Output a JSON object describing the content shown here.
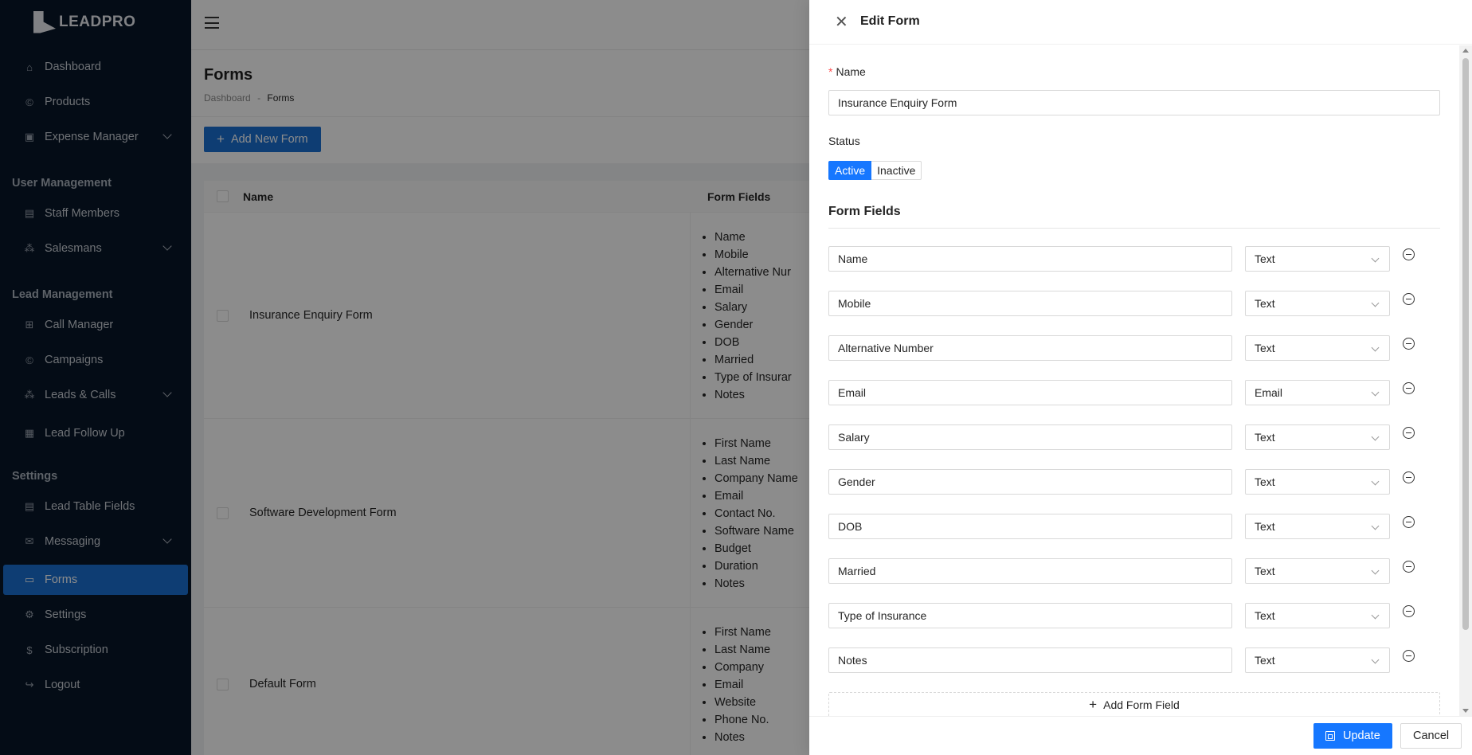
{
  "brand": {
    "name": "LEADPRO"
  },
  "sidebar": {
    "items": [
      {
        "label": "Dashboard",
        "icon": "home-icon",
        "glyph": "⌂"
      },
      {
        "label": "Products",
        "icon": "copyright-icon",
        "glyph": "©"
      },
      {
        "label": "Expense Manager",
        "icon": "ledger-icon",
        "glyph": "▣"
      }
    ],
    "group_user": "User Management",
    "user_items": [
      {
        "label": "Staff Members",
        "icon": "document-icon",
        "glyph": "▤"
      },
      {
        "label": "Salesmans",
        "icon": "cluster-icon",
        "glyph": "⁂"
      }
    ],
    "group_lead": "Lead Management",
    "lead_items": [
      {
        "label": "Call Manager",
        "icon": "grid-icon",
        "glyph": "⊞"
      },
      {
        "label": "Campaigns",
        "icon": "copyright-icon",
        "glyph": "©"
      },
      {
        "label": "Leads & Calls",
        "icon": "cluster-icon",
        "glyph": "⁂"
      },
      {
        "label": "Lead Follow Up",
        "icon": "calendar-icon",
        "glyph": "▦"
      }
    ],
    "group_settings": "Settings",
    "settings_items": [
      {
        "label": "Lead Table Fields",
        "icon": "table-icon",
        "glyph": "▤"
      },
      {
        "label": "Messaging",
        "icon": "mail-icon",
        "glyph": "✉"
      },
      {
        "label": "Forms",
        "icon": "folder-open-icon",
        "glyph": "▭"
      },
      {
        "label": "Settings",
        "icon": "gear-icon",
        "glyph": "⚙"
      },
      {
        "label": "Subscription",
        "icon": "dollar-icon",
        "glyph": "$"
      },
      {
        "label": "Logout",
        "icon": "logout-icon",
        "glyph": "↪"
      }
    ]
  },
  "page": {
    "title": "Forms",
    "breadcrumb": [
      "Dashboard",
      "-",
      "Forms"
    ],
    "add_button": "Add New Form"
  },
  "table": {
    "headers": [
      "Name",
      "Form Fields"
    ],
    "rows": [
      {
        "name": "Insurance Enquiry Form",
        "fields": [
          "Name",
          "Mobile",
          "Alternative Nur",
          "Email",
          "Salary",
          "Gender",
          "DOB",
          "Married",
          "Type of Insurar",
          "Notes"
        ]
      },
      {
        "name": "Software Development Form",
        "fields": [
          "First Name",
          "Last Name",
          "Company Name",
          "Email",
          "Contact No.",
          "Software Name",
          "Budget",
          "Duration",
          "Notes"
        ]
      },
      {
        "name": "Default Form",
        "fields": [
          "First Name",
          "Last Name",
          "Company",
          "Email",
          "Website",
          "Phone No.",
          "Notes"
        ]
      }
    ]
  },
  "drawer": {
    "title": "Edit Form",
    "name_label": "Name",
    "name_required": "*",
    "name_value": "Insurance Enquiry Form",
    "status_label": "Status",
    "status_options": [
      "Active",
      "Inactive"
    ],
    "status_selected": "Active",
    "fields_title": "Form Fields",
    "fields": [
      {
        "name": "Name",
        "type": "Text"
      },
      {
        "name": "Mobile",
        "type": "Text"
      },
      {
        "name": "Alternative Number",
        "type": "Text"
      },
      {
        "name": "Email",
        "type": "Email"
      },
      {
        "name": "Salary",
        "type": "Text"
      },
      {
        "name": "Gender",
        "type": "Text"
      },
      {
        "name": "DOB",
        "type": "Text"
      },
      {
        "name": "Married",
        "type": "Text"
      },
      {
        "name": "Type of Insurance",
        "type": "Text"
      },
      {
        "name": "Notes",
        "type": "Text"
      }
    ],
    "add_field_label": "Add Form Field",
    "update_label": "Update",
    "cancel_label": "Cancel"
  },
  "colors": {
    "sidebar_bg": "#081628",
    "primary": "#1677ff",
    "active_nav": "#1a6fd1"
  }
}
